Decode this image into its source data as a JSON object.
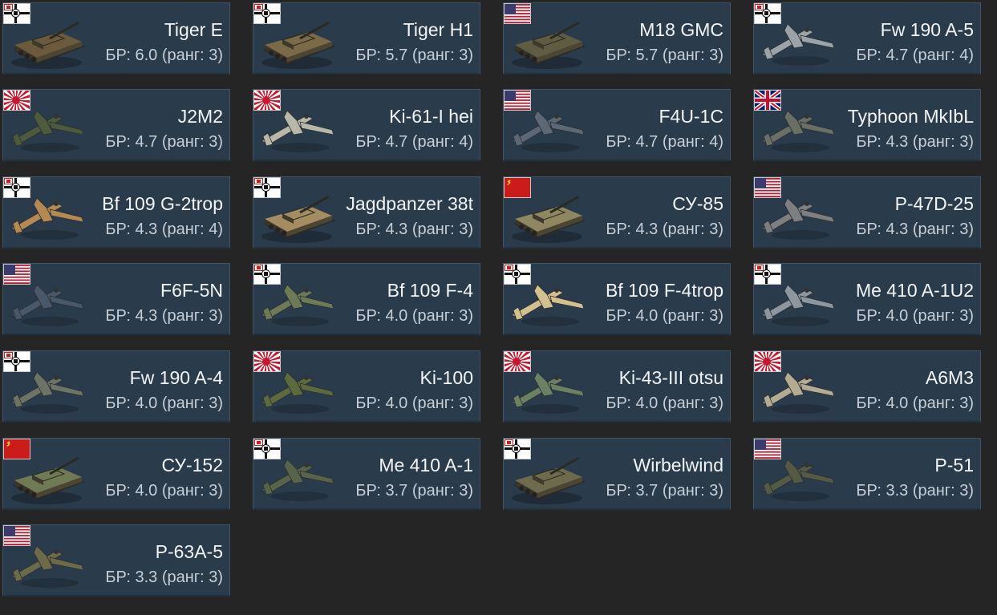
{
  "cards": [
    {
      "name": "Tiger E",
      "br": "БР: 6.0 (ранг: 3)",
      "flag": "germany",
      "icon": "tank-icon",
      "type": "tank",
      "color": "#6b5a3c"
    },
    {
      "name": "Tiger H1",
      "br": "БР: 5.7 (ранг: 3)",
      "flag": "germany",
      "icon": "tank-icon",
      "type": "tank",
      "color": "#7a6a48"
    },
    {
      "name": "M18 GMC",
      "br": "БР: 5.7 (ранг: 3)",
      "flag": "usa",
      "icon": "tank-icon",
      "type": "tank",
      "color": "#5f5c44"
    },
    {
      "name": "Fw 190 A-5",
      "br": "БР: 4.7 (ранг: 4)",
      "flag": "germany",
      "icon": "plane-icon",
      "type": "plane",
      "color": "#9aa3a8"
    },
    {
      "name": "J2M2",
      "br": "БР: 4.7 (ранг: 3)",
      "flag": "japan",
      "icon": "plane-icon",
      "type": "plane",
      "color": "#4d5a3c"
    },
    {
      "name": "Ki-61-I hei",
      "br": "БР: 4.7 (ранг: 4)",
      "flag": "japan",
      "icon": "plane-icon",
      "type": "plane",
      "color": "#b9b8a8"
    },
    {
      "name": "F4U-1C",
      "br": "БР: 4.7 (ранг: 4)",
      "flag": "usa",
      "icon": "plane-icon",
      "type": "plane",
      "color": "#5c6876"
    },
    {
      "name": "Typhoon MkIbL",
      "br": "БР: 4.3 (ранг: 3)",
      "flag": "uk",
      "icon": "plane-icon",
      "type": "plane",
      "color": "#6a6f66"
    },
    {
      "name": "Bf 109 G-2trop",
      "br": "БР: 4.3 (ранг: 4)",
      "flag": "germany",
      "icon": "plane-icon",
      "type": "plane",
      "color": "#b58a52"
    },
    {
      "name": "Jagdpanzer 38t",
      "br": "БР: 4.3 (ранг: 3)",
      "flag": "germany",
      "icon": "tank-icon",
      "type": "tank",
      "color": "#a48c62"
    },
    {
      "name": "СУ-85",
      "br": "БР: 4.3 (ранг: 3)",
      "flag": "ussr",
      "icon": "tank-icon",
      "type": "tank",
      "color": "#8f8762"
    },
    {
      "name": "P-47D-25",
      "br": "БР: 4.3 (ранг: 3)",
      "flag": "usa",
      "icon": "plane-icon",
      "type": "plane",
      "color": "#7d7f80"
    },
    {
      "name": "F6F-5N",
      "br": "БР: 4.3 (ранг: 3)",
      "flag": "usa",
      "icon": "plane-icon",
      "type": "plane",
      "color": "#495868"
    },
    {
      "name": "Bf 109 F-4",
      "br": "БР: 4.0 (ранг: 3)",
      "flag": "germany",
      "icon": "plane-icon",
      "type": "plane",
      "color": "#6e7a56"
    },
    {
      "name": "Bf 109 F-4trop",
      "br": "БР: 4.0 (ранг: 3)",
      "flag": "germany",
      "icon": "plane-icon",
      "type": "plane",
      "color": "#d2c08e"
    },
    {
      "name": "Me 410 A-1U2",
      "br": "БР: 4.0 (ранг: 3)",
      "flag": "germany",
      "icon": "plane-icon",
      "type": "plane",
      "color": "#8d97a0"
    },
    {
      "name": "Fw 190 A-4",
      "br": "БР: 4.0 (ранг: 3)",
      "flag": "germany",
      "icon": "plane-icon",
      "type": "plane",
      "color": "#6c7466"
    },
    {
      "name": "Ki-100",
      "br": "БР: 4.0 (ранг: 3)",
      "flag": "japan",
      "icon": "plane-icon",
      "type": "plane",
      "color": "#5d6a3e"
    },
    {
      "name": "Ki-43-III otsu",
      "br": "БР: 4.0 (ранг: 3)",
      "flag": "japan",
      "icon": "plane-icon",
      "type": "plane",
      "color": "#6c8064"
    },
    {
      "name": "A6M3",
      "br": "БР: 4.0 (ранг: 3)",
      "flag": "japan",
      "icon": "plane-icon",
      "type": "plane",
      "color": "#b4ac92"
    },
    {
      "name": "СУ-152",
      "br": "БР: 4.0 (ранг: 3)",
      "flag": "ussr",
      "icon": "tank-icon",
      "type": "tank",
      "color": "#707a55"
    },
    {
      "name": "Me 410 A-1",
      "br": "БР: 3.7 (ранг: 3)",
      "flag": "germany",
      "icon": "plane-icon",
      "type": "plane",
      "color": "#58644a"
    },
    {
      "name": "Wirbelwind",
      "br": "БР: 3.7 (ранг: 3)",
      "flag": "germany",
      "icon": "tank-icon",
      "type": "tank",
      "color": "#6e6a4e"
    },
    {
      "name": "P-51",
      "br": "БР: 3.3 (ранг: 3)",
      "flag": "usa",
      "icon": "plane-icon",
      "type": "plane",
      "color": "#545a44"
    },
    {
      "name": "P-63A-5",
      "br": "БР: 3.3 (ранг: 3)",
      "flag": "usa",
      "icon": "plane-icon",
      "type": "plane",
      "color": "#6c6a48"
    }
  ]
}
